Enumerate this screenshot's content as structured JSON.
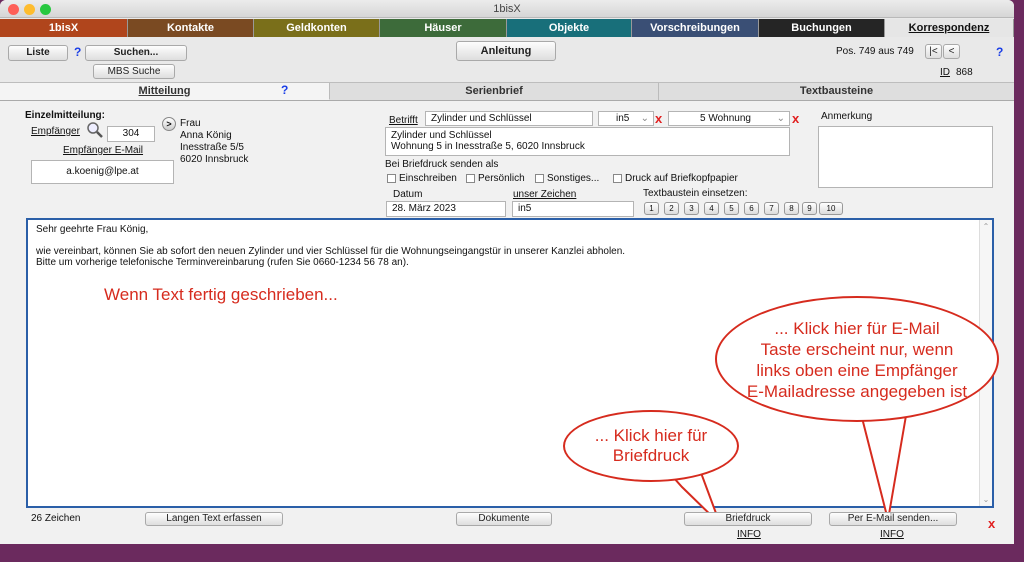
{
  "window": {
    "title": "1bisX"
  },
  "tabs": [
    {
      "label": "1bisX",
      "color": "#b0451c"
    },
    {
      "label": "Kontakte",
      "color": "#7a4a22"
    },
    {
      "label": "Geldkonten",
      "color": "#7a6f1a"
    },
    {
      "label": "Häuser",
      "color": "#3d6b3a"
    },
    {
      "label": "Objekte",
      "color": "#186f7a"
    },
    {
      "label": "Vorschreibungen",
      "color": "#3a4f75"
    },
    {
      "label": "Buchungen",
      "color": "#252525"
    },
    {
      "label": "Korrespondenz",
      "color": "#e6e6e6"
    }
  ],
  "toolbar": {
    "liste": "Liste",
    "suchen": "Suchen...",
    "mbs_suche": "MBS Suche",
    "anleitung": "Anleitung",
    "pos_text": "Pos. 749 aus 749",
    "nav_first": "|<",
    "nav_prev": "<",
    "id_label": "ID",
    "id_value": "868"
  },
  "subtabs": {
    "mitteilung": "Mitteilung",
    "help": "?",
    "serienbrief": "Serienbrief",
    "textbausteine": "Textbausteine"
  },
  "recipient": {
    "heading": "Einzelmitteilung:",
    "empfaenger_label": "Empfänger",
    "empfaenger_id": "304",
    "go": ">",
    "email_label": "Empfänger E-Mail",
    "email": "a.koenig@lpe.at",
    "address": [
      "Frau",
      "Anna König",
      "Inesstraße 5/5",
      "6020 Innsbruck"
    ]
  },
  "betreff": {
    "label": "Betrifft",
    "value": "Zylinder und Schlüssel",
    "user": "in5",
    "wohnung": "5 Wohnung",
    "text": [
      "Zylinder und Schlüssel",
      "Wohnung 5 in Inesstraße 5, 6020 Innsbruck"
    ]
  },
  "anmerkung": {
    "label": "Anmerkung"
  },
  "print_options": {
    "heading": "Bei Briefdruck senden als",
    "options": [
      "Einschreiben",
      "Persönlich",
      "Sonstiges...",
      "Druck auf Briefkopfpapier"
    ]
  },
  "datum": {
    "label": "Datum",
    "value": "28. März 2023",
    "zeichen_label": "unser Zeichen",
    "zeichen_value": "in5"
  },
  "textbaustein": {
    "label": "Textbaustein einsetzen:",
    "numbers": [
      "1",
      "2",
      "3",
      "4",
      "5",
      "6",
      "7",
      "8",
      "9",
      "10"
    ]
  },
  "letter": {
    "lines": [
      "Sehr geehrte Frau König,",
      "",
      "wie vereinbart, können Sie ab sofort den neuen Zylinder und vier Schlüssel für die Wohnungseingangstür in unserer Kanzlei abholen.",
      "Bitte um vorherige telefonische Terminvereinbarung (rufen Sie 0660-1234 56 78 an)."
    ]
  },
  "annotations": {
    "fertig": "Wenn Text fertig geschrieben...",
    "briefdruck": [
      "... Klick hier für",
      "Briefdruck"
    ],
    "email": [
      "... Klick hier für E-Mail",
      "Taste erscheint nur, wenn",
      "links oben eine Empfänger",
      "E-Mailadresse angegeben ist"
    ]
  },
  "bottom": {
    "count": "26 Zeichen",
    "langen_text": "Langen Text erfassen",
    "dokumente": "Dokumente",
    "briefdruck": "Briefdruck",
    "email_send": "Per E-Mail senden...",
    "info": "INFO",
    "x": "x"
  },
  "colors": {
    "accent_red": "#d62b1e",
    "help_blue": "#1a3ee6",
    "desktop": "#6b2a5e"
  }
}
